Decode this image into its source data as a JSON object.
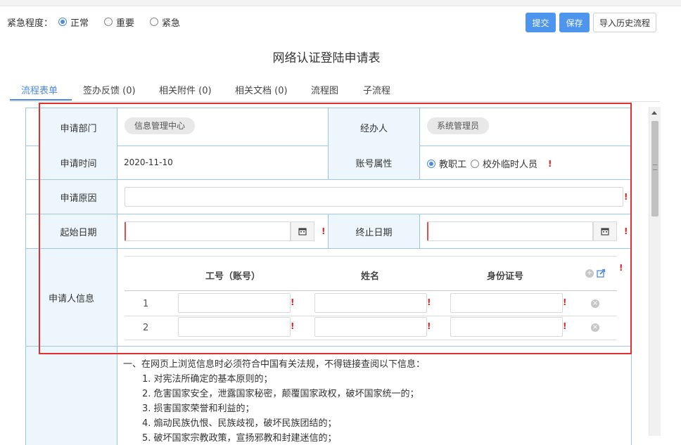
{
  "urgency": {
    "label": "紧急程度：",
    "options": [
      {
        "label": "正常",
        "selected": true
      },
      {
        "label": "重要",
        "selected": false
      },
      {
        "label": "紧急",
        "selected": false
      }
    ]
  },
  "toolbar": {
    "submit_label": "提交",
    "save_label": "保存",
    "import_label": "导入历史流程"
  },
  "form_title": "网络认证登陆申请表",
  "tabs": [
    {
      "label": "流程表单",
      "active": true
    },
    {
      "label": "签办反馈 (0)",
      "active": false
    },
    {
      "label": "相关附件 (0)",
      "active": false
    },
    {
      "label": "相关文档 (0)",
      "active": false
    },
    {
      "label": "流程图",
      "active": false
    },
    {
      "label": "子流程",
      "active": false
    }
  ],
  "form": {
    "department": {
      "label": "申请部门",
      "value": "信息管理中心"
    },
    "handler": {
      "label": "经办人",
      "value": "系统管理员"
    },
    "apply_time": {
      "label": "申请时间",
      "value": "2020-11-10"
    },
    "account_type": {
      "label": "账号属性",
      "options": [
        {
          "label": "教职工",
          "selected": true
        },
        {
          "label": "校外临时人员",
          "selected": false
        }
      ]
    },
    "reason": {
      "label": "申请原因",
      "value": ""
    },
    "start_date": {
      "label": "起始日期",
      "value": ""
    },
    "end_date": {
      "label": "终止日期",
      "value": ""
    },
    "applicant_info": {
      "label": "申请人信息",
      "columns": [
        "工号（账号）",
        "姓名",
        "身份证号"
      ],
      "rows": [
        {
          "index": "1",
          "id": "",
          "name": "",
          "id_card": ""
        },
        {
          "index": "2",
          "id": "",
          "name": "",
          "id_card": ""
        }
      ]
    },
    "required_mark": "!"
  },
  "notice": {
    "lines": [
      "一、在网页上浏览信息时必须符合中国有关法规，不得链接查阅以下信息：",
      "1. 对宪法所确定的基本原则的；",
      "2. 危害国家安全，泄露国家秘密，颠覆国家政权，破坏国家统一的；",
      "3. 损害国家荣誉和利益的；",
      "4. 煽动民族仇恨、民族歧视，破坏民族团结的；",
      "5. 破坏国家宗教政策，宣扬邪教和封建迷信的；"
    ]
  },
  "colors": {
    "accent": "#4a8be0",
    "primary_button": "#4e95ee",
    "label_cell_bg": "#edf6fc",
    "table_border": "#9cc7e7",
    "required": "#e02020",
    "highlight_box": "#e23030"
  }
}
